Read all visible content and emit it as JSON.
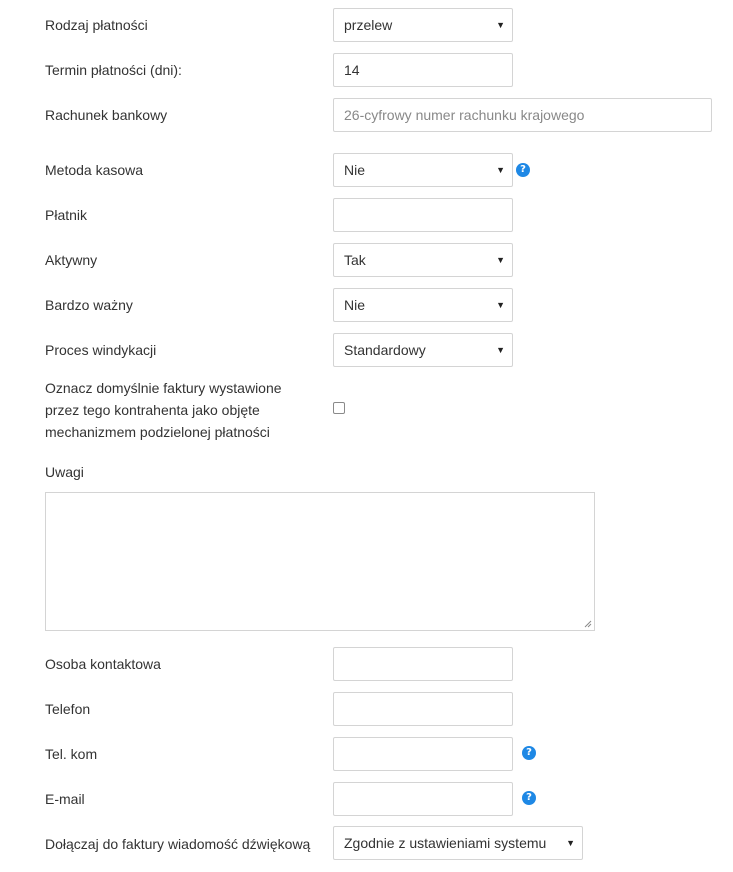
{
  "form": {
    "payment_type": {
      "label": "Rodzaj płatności",
      "value": "przelew"
    },
    "payment_term": {
      "label": "Termin płatności (dni):",
      "value": "14"
    },
    "bank_account": {
      "label": "Rachunek bankowy",
      "placeholder": "26-cyfrowy numer rachunku krajowego"
    },
    "cash_method": {
      "label": "Metoda kasowa",
      "value": "Nie"
    },
    "payer": {
      "label": "Płatnik",
      "value": ""
    },
    "active": {
      "label": "Aktywny",
      "value": "Tak"
    },
    "very_important": {
      "label": "Bardzo ważny",
      "value": "Nie"
    },
    "collection_process": {
      "label": "Proces windykacji",
      "value": "Standardowy"
    },
    "split_payment": {
      "label_lines": [
        "Oznacz domyślnie faktury wystawione",
        "przez tego kontrahenta jako objęte",
        "mechanizmem podzielonej płatności"
      ],
      "checked": false
    },
    "notes": {
      "label": "Uwagi",
      "value": ""
    },
    "contact_person": {
      "label": "Osoba kontaktowa",
      "value": ""
    },
    "phone": {
      "label": "Telefon",
      "value": ""
    },
    "mobile": {
      "label": "Tel. kom",
      "value": ""
    },
    "email": {
      "label": "E-mail",
      "value": ""
    },
    "voice_message": {
      "label": "Dołączaj do faktury wiadomość dźwiękową",
      "value": "Zgodnie z ustawieniami systemu"
    }
  },
  "icons": {
    "help": "question-circle-icon",
    "dropdown": "caret-down-icon",
    "help_color": "#1e88e5"
  },
  "glyphs": {
    "help": "?",
    "caret": "▼"
  }
}
